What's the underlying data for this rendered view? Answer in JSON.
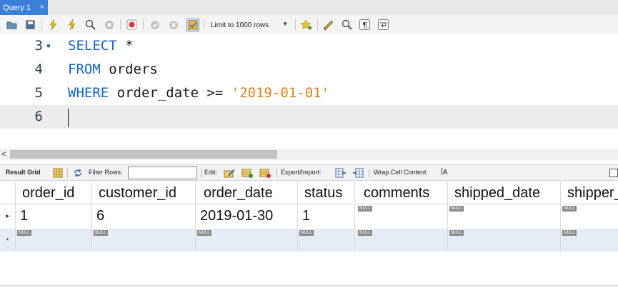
{
  "tab": {
    "title": "Query 1",
    "close": "×"
  },
  "toolbar": {
    "icons": [
      "open-folder-icon",
      "save-icon",
      "execute-icon",
      "execute-current-icon",
      "explain-icon",
      "stop-icon",
      "toggle-error-icon",
      "commit-icon",
      "rollback-icon",
      "autocommit-icon",
      "bookmark-icon",
      "beautify-icon",
      "find-icon",
      "invisible-chars-icon",
      "wrap-icon"
    ],
    "limit_label": "Limit to 1000 rows"
  },
  "editor": {
    "lines": [
      {
        "number": "3",
        "marker": "•"
      },
      {
        "number": "4"
      },
      {
        "number": "5"
      },
      {
        "number": "6"
      }
    ],
    "code": {
      "l3_kw": "SELECT",
      "l3_rest": " *",
      "l4_kw": "FROM",
      "l4_rest": " orders",
      "l5_kw": "WHERE",
      "l5_mid": " order_date >= ",
      "l5_str": "'2019-01-01'"
    }
  },
  "scrollbar": {
    "left_arrow": "<"
  },
  "result_toolbar": {
    "result_grid": "Result Grid",
    "filter_rows": "Filter Rows:",
    "edit": "Edit:",
    "export_import": "Export/Import:",
    "wrap_cell": "Wrap Cell Content:",
    "wrap_icon_glyph": "ĪA"
  },
  "grid": {
    "columns": [
      "order_id",
      "customer_id",
      "order_date",
      "status",
      "comments",
      "shipped_date",
      "shipper_id"
    ],
    "rows": [
      {
        "indicator": "▸",
        "order_id": "1",
        "customer_id": "6",
        "order_date": "2019-01-30",
        "status": "1",
        "comments": "NULL",
        "shipped_date": "NULL",
        "shipper_id": "NULL"
      }
    ],
    "new_row": {
      "indicator": "*",
      "null_label": "NULL"
    }
  }
}
